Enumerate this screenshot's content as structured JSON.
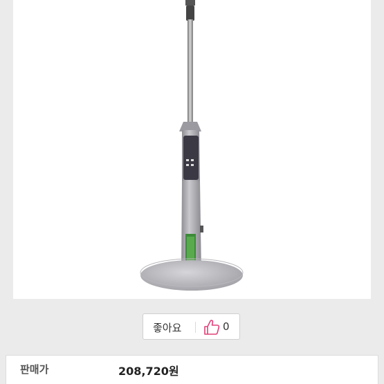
{
  "product": {
    "image": "standing-fan-stand",
    "like_label": "좋아요",
    "like_icon": "thumbs-up-icon",
    "like_count": "0",
    "price_label": "판매가",
    "price_value": "208,720원"
  },
  "colors": {
    "background": "#ebebeb",
    "like_icon": "#e0407a"
  }
}
